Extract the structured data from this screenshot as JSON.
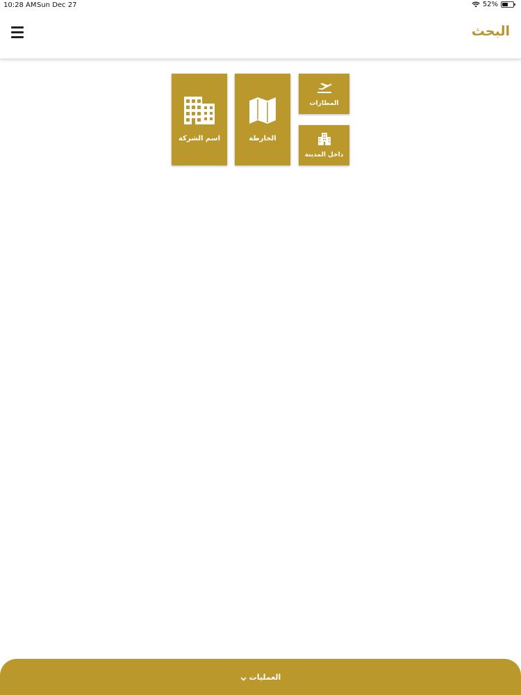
{
  "status_bar": {
    "time": "10:28 AM",
    "date": "Sun Dec 27",
    "battery_percent": "52%",
    "battery_level": 0.52
  },
  "nav": {
    "title": "البحث",
    "menu_icon": "hamburger-menu-icon"
  },
  "tiles": {
    "company_name": {
      "label": "اسم الشركة",
      "icon": "building-icon"
    },
    "map": {
      "label": "الخارطة",
      "icon": "map-icon"
    },
    "airports": {
      "label": "المطارات",
      "icon": "airplane-departure-icon"
    },
    "in_city": {
      "label": "داخل المدينة",
      "icon": "city-building-icon"
    }
  },
  "bottom_bar": {
    "label": "العمليات",
    "icon": "chevron-down-icon"
  },
  "colors": {
    "accent": "#bb982c",
    "title": "#b8962d"
  }
}
